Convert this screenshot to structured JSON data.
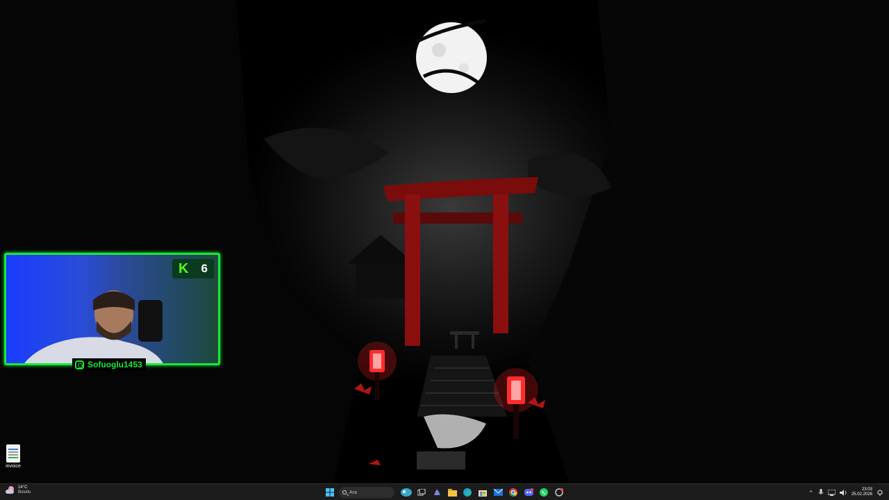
{
  "desktop": {
    "icons": [
      {
        "label": "invoice",
        "icon": "document-icon"
      }
    ]
  },
  "webcam_overlay": {
    "badge_letter": "K",
    "badge_count": "6",
    "social_icon": "instagram-icon",
    "username": "Sofuoglu1453",
    "accent_color": "#19e83a"
  },
  "taskbar": {
    "weather": {
      "temperature": "14°C",
      "condition": "Bulutlu"
    },
    "search": {
      "placeholder": "Ara"
    },
    "pinned": [
      "start-icon",
      "search-icon",
      "widgets-icon",
      "task-view-icon",
      "copilot-icon",
      "file-explorer-icon",
      "edge-icon",
      "microsoft-store-icon",
      "mail-icon",
      "chrome-icon",
      "discord-icon",
      "whatsapp-icon",
      "app-icon"
    ],
    "clock": {
      "time": "23:03",
      "date": "25.02.2026"
    }
  }
}
